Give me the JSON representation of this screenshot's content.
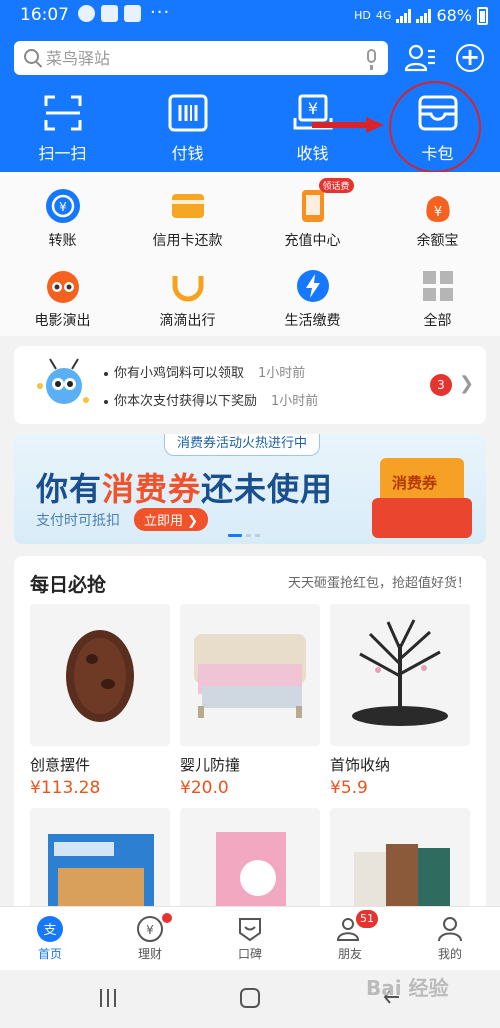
{
  "status_bar": {
    "time": "16:07",
    "more": "···",
    "network": "HD",
    "signal": "4G",
    "battery": "68%"
  },
  "search": {
    "placeholder": "菜鸟驿站",
    "icon": "search-icon"
  },
  "header_actions": [
    {
      "label": "扫一扫",
      "icon": "scan-icon"
    },
    {
      "label": "付钱",
      "icon": "barcode-icon"
    },
    {
      "label": "收钱",
      "icon": "receive-money-icon"
    },
    {
      "label": "卡包",
      "icon": "card-wallet-icon"
    }
  ],
  "services": [
    {
      "label": "转账",
      "icon": "transfer-icon",
      "color": "#1677ff"
    },
    {
      "label": "信用卡还款",
      "icon": "credit-card-icon",
      "color": "#f5a623"
    },
    {
      "label": "充值中心",
      "icon": "phone-topup-icon",
      "color": "#f7901e",
      "badge": "领话费"
    },
    {
      "label": "余额宝",
      "icon": "yuebao-icon",
      "color": "#f5621f"
    },
    {
      "label": "电影演出",
      "icon": "movie-icon",
      "color": "#f5621f"
    },
    {
      "label": "滴滴出行",
      "icon": "didi-icon",
      "color": "#f7a21e"
    },
    {
      "label": "生活缴费",
      "icon": "utility-icon",
      "color": "#1677ff"
    },
    {
      "label": "全部",
      "icon": "all-grid-icon",
      "color": "#999999"
    }
  ],
  "notifications": {
    "items": [
      {
        "text": "你有小鸡饲料可以领取",
        "time": "1小时前"
      },
      {
        "text": "你本次支付获得以下奖励",
        "time": "1小时前"
      }
    ],
    "count": "3"
  },
  "banner": {
    "pill": "消费券活动火热进行中",
    "headline_a": "你有",
    "headline_b": "消费券",
    "headline_c": "还未使用",
    "sub": "支付时可抵扣",
    "cta": "立即用 ❯",
    "coupon_text": "消费券"
  },
  "deals": {
    "title": "每日必抢",
    "slogan": "天天砸蛋抢红包，抢超值好货！",
    "products": [
      {
        "name": "创意摆件",
        "price": "¥113.28"
      },
      {
        "name": "婴儿防撞",
        "price": "¥20.0"
      },
      {
        "name": "首饰收纳",
        "price": "¥5.9"
      }
    ]
  },
  "tabbar": [
    {
      "label": "首页",
      "icon": "alipay-home-icon",
      "active": true
    },
    {
      "label": "理财",
      "icon": "wealth-icon",
      "dot": true
    },
    {
      "label": "口碑",
      "icon": "koubei-icon"
    },
    {
      "label": "朋友",
      "icon": "friends-icon",
      "count": "51"
    },
    {
      "label": "我的",
      "icon": "profile-icon"
    }
  ],
  "watermark": "Bai  经验",
  "colors": {
    "primary": "#1677ff",
    "accent_red": "#e5342f",
    "price": "#e8541e"
  }
}
